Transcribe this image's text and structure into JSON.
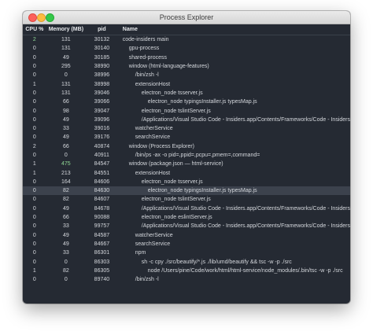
{
  "window": {
    "title": "Process Explorer"
  },
  "table": {
    "headers": {
      "cpu": "CPU %",
      "memory": "Memory (MB)",
      "pid": "pid",
      "name": "Name"
    },
    "rows": [
      {
        "cpu": "2",
        "memory": "131",
        "pid": "30132",
        "name": "code-insiders main",
        "depth": 0,
        "cpu_hl": true,
        "mem_hl": false
      },
      {
        "cpu": "0",
        "memory": "131",
        "pid": "30140",
        "name": "gpu-process",
        "depth": 1,
        "cpu_hl": false,
        "mem_hl": false
      },
      {
        "cpu": "0",
        "memory": "49",
        "pid": "30185",
        "name": "shared-process",
        "depth": 1,
        "cpu_hl": false,
        "mem_hl": false
      },
      {
        "cpu": "0",
        "memory": "295",
        "pid": "38990",
        "name": "window (html-language-features)",
        "depth": 1,
        "cpu_hl": false,
        "mem_hl": false
      },
      {
        "cpu": "0",
        "memory": "0",
        "pid": "38996",
        "name": "/bin/zsh -l",
        "depth": 2,
        "cpu_hl": false,
        "mem_hl": false
      },
      {
        "cpu": "1",
        "memory": "131",
        "pid": "38998",
        "name": "extensionHost",
        "depth": 2,
        "cpu_hl": false,
        "mem_hl": false
      },
      {
        "cpu": "0",
        "memory": "131",
        "pid": "39046",
        "name": "electron_node tsserver.js",
        "depth": 3,
        "cpu_hl": false,
        "mem_hl": false
      },
      {
        "cpu": "0",
        "memory": "66",
        "pid": "39066",
        "name": "electron_node typingsInstaller.js typesMap.js",
        "depth": 4,
        "cpu_hl": false,
        "mem_hl": false
      },
      {
        "cpu": "0",
        "memory": "98",
        "pid": "39047",
        "name": "electron_node tslintServer.js",
        "depth": 3,
        "cpu_hl": false,
        "mem_hl": false
      },
      {
        "cpu": "0",
        "memory": "49",
        "pid": "39096",
        "name": "/Applications/Visual Studio Code - Insiders.app/Contents/Frameworks/Code - Insiders",
        "depth": 3,
        "cpu_hl": false,
        "mem_hl": false
      },
      {
        "cpu": "0",
        "memory": "33",
        "pid": "39016",
        "name": "watcherService",
        "depth": 2,
        "cpu_hl": false,
        "mem_hl": false
      },
      {
        "cpu": "0",
        "memory": "49",
        "pid": "39176",
        "name": "searchService",
        "depth": 2,
        "cpu_hl": false,
        "mem_hl": false
      },
      {
        "cpu": "2",
        "memory": "66",
        "pid": "40874",
        "name": "window (Process Explorer)",
        "depth": 1,
        "cpu_hl": false,
        "mem_hl": false
      },
      {
        "cpu": "0",
        "memory": "0",
        "pid": "40911",
        "name": "/bin/ps -ax -o pid=,ppid=,pcpu=,pmem=,command=",
        "depth": 2,
        "cpu_hl": false,
        "mem_hl": false
      },
      {
        "cpu": "1",
        "memory": "475",
        "pid": "84547",
        "name": "window (package.json — html-service)",
        "depth": 1,
        "cpu_hl": false,
        "mem_hl": true
      },
      {
        "cpu": "1",
        "memory": "213",
        "pid": "84551",
        "name": "extensionHost",
        "depth": 2,
        "cpu_hl": false,
        "mem_hl": false
      },
      {
        "cpu": "0",
        "memory": "164",
        "pid": "84606",
        "name": "electron_node tsserver.js",
        "depth": 3,
        "cpu_hl": false,
        "mem_hl": false
      },
      {
        "cpu": "0",
        "memory": "82",
        "pid": "84630",
        "name": "electron_node typingsInstaller.js typesMap.js",
        "depth": 4,
        "cpu_hl": false,
        "mem_hl": false,
        "selected": true
      },
      {
        "cpu": "0",
        "memory": "82",
        "pid": "84607",
        "name": "electron_node tslintServer.js",
        "depth": 3,
        "cpu_hl": false,
        "mem_hl": false
      },
      {
        "cpu": "0",
        "memory": "49",
        "pid": "84678",
        "name": "/Applications/Visual Studio Code - Insiders.app/Contents/Frameworks/Code - Insiders",
        "depth": 3,
        "cpu_hl": false,
        "mem_hl": false
      },
      {
        "cpu": "0",
        "memory": "66",
        "pid": "90088",
        "name": "electron_node eslintServer.js",
        "depth": 3,
        "cpu_hl": false,
        "mem_hl": false
      },
      {
        "cpu": "0",
        "memory": "33",
        "pid": "99757",
        "name": "/Applications/Visual Studio Code - Insiders.app/Contents/Frameworks/Code - Insiders",
        "depth": 3,
        "cpu_hl": false,
        "mem_hl": false
      },
      {
        "cpu": "0",
        "memory": "49",
        "pid": "84587",
        "name": "watcherService",
        "depth": 2,
        "cpu_hl": false,
        "mem_hl": false
      },
      {
        "cpu": "0",
        "memory": "49",
        "pid": "84667",
        "name": "searchService",
        "depth": 2,
        "cpu_hl": false,
        "mem_hl": false
      },
      {
        "cpu": "0",
        "memory": "33",
        "pid": "86301",
        "name": "npm",
        "depth": 2,
        "cpu_hl": false,
        "mem_hl": false
      },
      {
        "cpu": "0",
        "memory": "0",
        "pid": "86303",
        "name": "sh -c cpy ./src/beautify/*.js ./lib/umd/beautify && tsc -w -p ./src",
        "depth": 3,
        "cpu_hl": false,
        "mem_hl": false
      },
      {
        "cpu": "1",
        "memory": "82",
        "pid": "86305",
        "name": "node /Users/pine/Code/work/html/html-service/node_modules/.bin/tsc -w -p ./src",
        "depth": 4,
        "cpu_hl": false,
        "mem_hl": false
      },
      {
        "cpu": "0",
        "memory": "0",
        "pid": "89740",
        "name": "/bin/zsh -l",
        "depth": 2,
        "cpu_hl": false,
        "mem_hl": false
      }
    ]
  },
  "colors": {
    "background": "#252a33",
    "text": "#d4d7dc",
    "highlight": "#8fd694",
    "selected_row": "#3c424d"
  }
}
